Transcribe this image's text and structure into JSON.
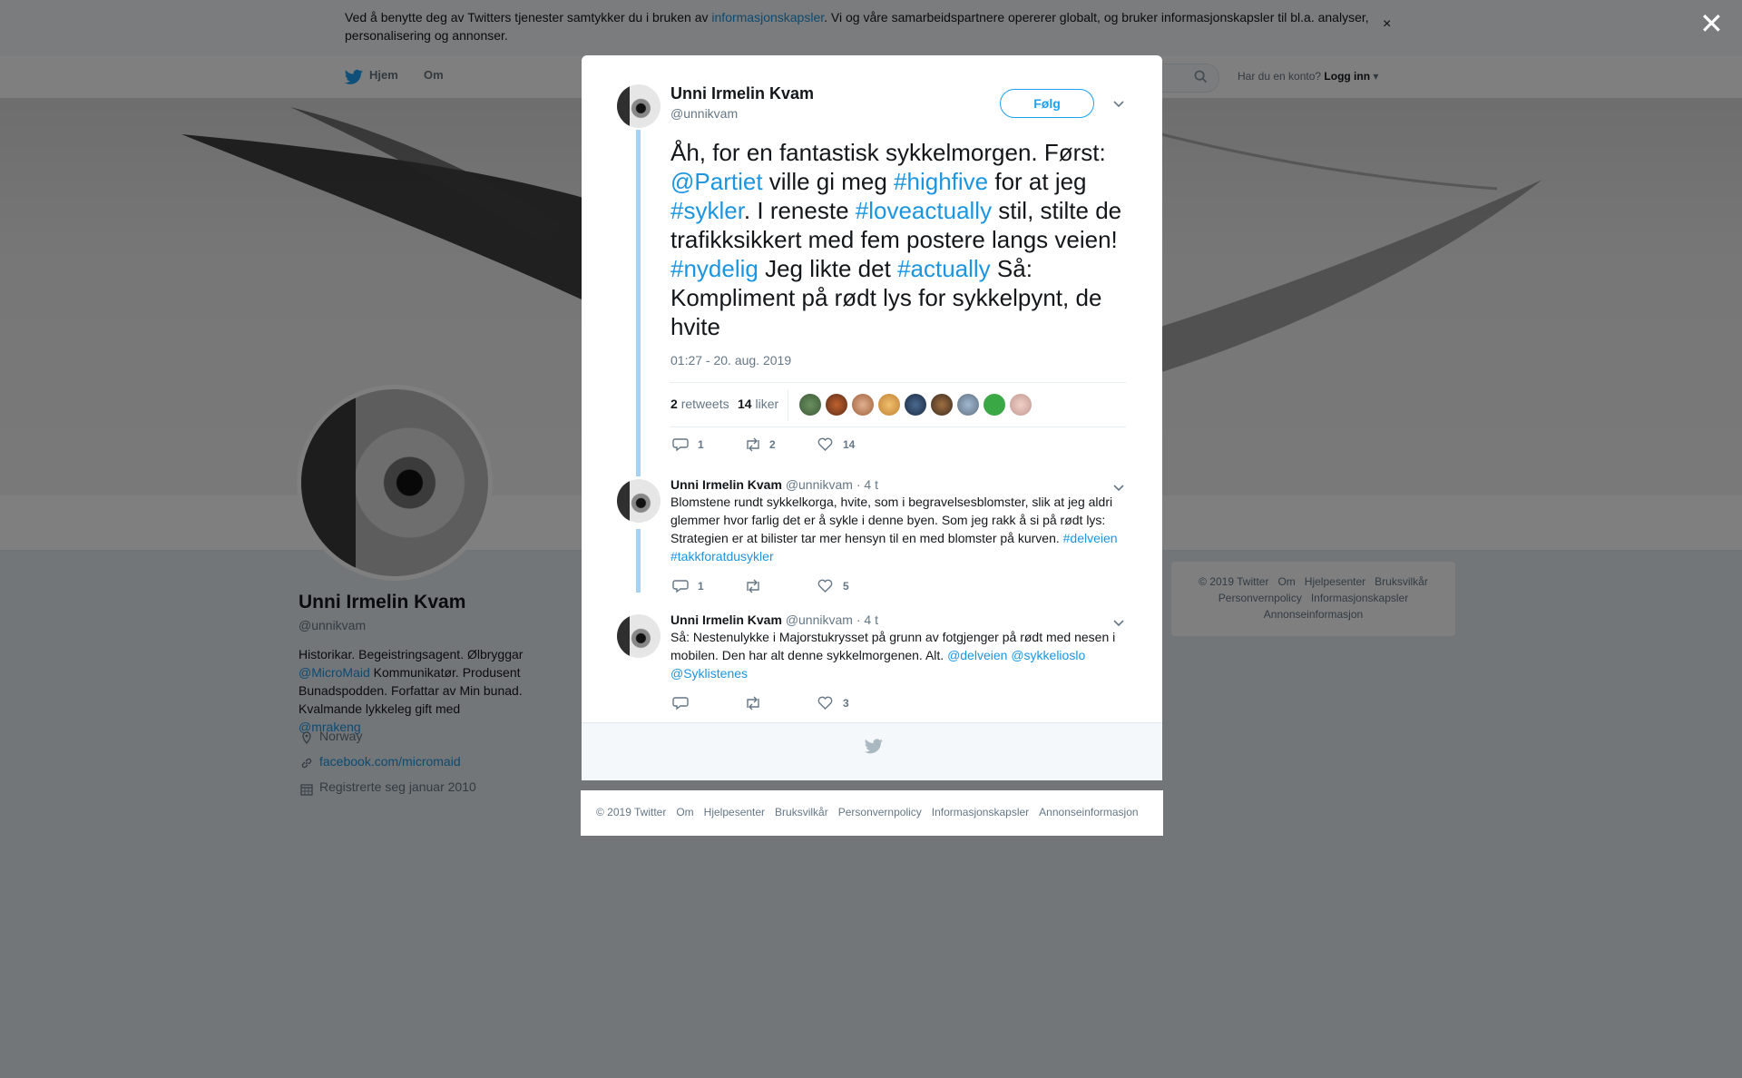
{
  "cookie": {
    "text_before": "Ved å benytte deg av Twitters tjenester samtykker du i bruken av ",
    "link": "informasjonskapsler",
    "text_after": ". Vi og våre samarbeidspartnere opererer globalt, og bruker informasjonskapsler til bl.a. analyser, personalisering og annonser.",
    "close": "×"
  },
  "nav": {
    "home": "Hjem",
    "about": "Om",
    "login_prompt": "Har du en konto?",
    "login": "Logg inn"
  },
  "profile": {
    "name": "Unni Irmelin Kvam",
    "handle": "@unnikvam",
    "bio_1": "Historikar. Begeistringsagent. Ølbryggar",
    "bio_link1": "@MicroMaid",
    "bio_2": " Kommunikatør. Produsent Bunadspodden. Forfattar av Min bunad. Kvalmande lykkeleg gift med ",
    "bio_link2": "@mrakeng",
    "location": "Norway",
    "website": "facebook.com/micromaid",
    "joined": "Registrerte seg januar 2010"
  },
  "side_footer": {
    "items": [
      "© 2019 Twitter",
      "Om",
      "Hjelpesenter",
      "Bruksvilkår",
      "Personvernpolicy",
      "Informasjonskapsler",
      "Annonseinformasjon"
    ]
  },
  "modal": {
    "close": "✕",
    "main_tweet": {
      "name": "Unni Irmelin Kvam",
      "handle": "@unnikvam",
      "follow": "Følg",
      "t1": "Åh, for en fantastisk sykkelmorgen. Først: ",
      "l1": "@Partiet",
      "t2": " ville gi meg ",
      "l2": "#highfive",
      "t3": " for at jeg ",
      "l3": "#sykler",
      "t4": ". I reneste ",
      "l4": "#loveactually",
      "t5": " stil, stilte de trafikksikkert med fem postere langs veien! ",
      "l5": "#nydelig",
      "t6": " Jeg likte det ",
      "l6": "#actually",
      "t7": " Så: Kompliment på rødt lys for sykkelpynt, de hvite",
      "time": "01:27 - 20. aug. 2019",
      "retweets_count": "2",
      "retweets_label": "retweets",
      "likes_count": "14",
      "likes_label": "liker",
      "reply_count": "1",
      "rt_count": "2",
      "like_count": "14"
    },
    "reply1": {
      "name": "Unni Irmelin Kvam",
      "handle": "@unnikvam",
      "time": "· 4 t",
      "text": "Blomstene rundt sykkelkorga, hvite, som i begravelsesblomster, slik at jeg aldri glemmer hvor farlig det er å sykle i denne byen. Som jeg rakk å si på rødt lys: Strategien er at bilister tar mer hensyn til en med blomster på kurven. ",
      "l1": "#delveien",
      "l2": "#takkforatdusykler",
      "reply_count": "1",
      "like_count": "5"
    },
    "reply2": {
      "name": "Unni Irmelin Kvam",
      "handle": "@unnikvam",
      "time": "· 4 t",
      "text": "Så: Nestenulykke i Majorstukrysset på grunn av fotgjenger på rødt med nesen i mobilen. Den har alt denne sykkelmorgenen. Alt. ",
      "l1": "@delveien",
      "l2": "@sykkelioslo",
      "l3": "@Syklistenes",
      "like_count": "3"
    }
  },
  "bottom_footer": {
    "items": [
      "© 2019 Twitter",
      "Om",
      "Hjelpesenter",
      "Bruksvilkår",
      "Personvernpolicy",
      "Informasjonskapsler",
      "Annonseinformasjon"
    ]
  },
  "colors": {
    "link": "#1b95e0",
    "follow": "#1da1f2",
    "thread": "#a6d3f2"
  },
  "icons": [
    "twitter-bird-icon",
    "search-icon",
    "close-icon",
    "chevron-down-icon",
    "reply-icon",
    "retweet-icon",
    "heart-icon",
    "location-icon",
    "link-icon",
    "calendar-icon"
  ]
}
